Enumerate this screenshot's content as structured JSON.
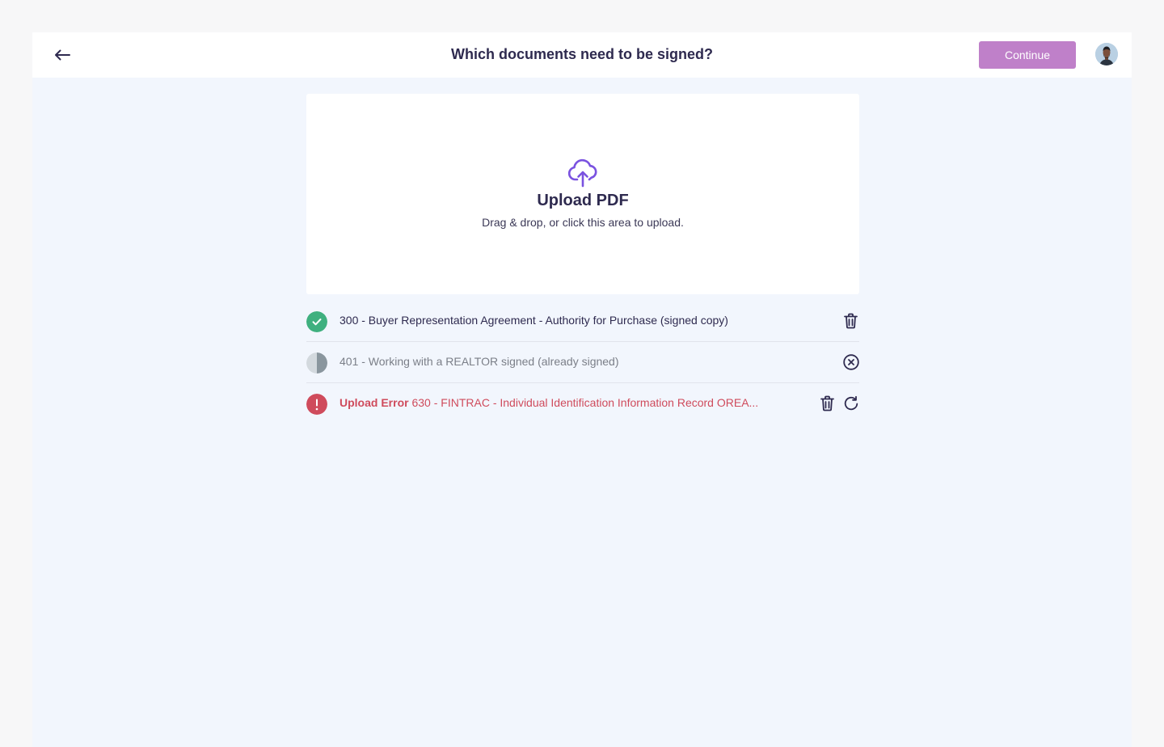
{
  "header": {
    "title": "Which documents need to be signed?",
    "continue_label": "Continue",
    "back_icon": "arrow-left-icon",
    "avatar_icon": "user-avatar"
  },
  "dropzone": {
    "icon": "cloud-upload-icon",
    "title": "Upload PDF",
    "subtitle": "Drag & drop, or click this area to upload."
  },
  "files": [
    {
      "status": "uploaded",
      "name": "300 - Buyer Representation Agreement - Authority for Purchase (signed copy)",
      "actions": [
        "trash-icon"
      ]
    },
    {
      "status": "uploading",
      "progress": 0.5,
      "name": "401 - Working with a REALTOR signed (already signed)",
      "actions": [
        "cancel-icon"
      ]
    },
    {
      "status": "error",
      "error_label": "Upload Error",
      "name": "630 - FINTRAC - Individual Identification Information Record OREA...",
      "actions": [
        "trash-icon",
        "retry-icon"
      ]
    }
  ],
  "colors": {
    "accent": "#bf80c9",
    "upload_icon": "#7a52e0",
    "success": "#3fb07f",
    "error": "#cf4b5c",
    "pending": "#a9b1b8",
    "text": "#2e2a4f",
    "app_background": "#f2f6fd"
  }
}
